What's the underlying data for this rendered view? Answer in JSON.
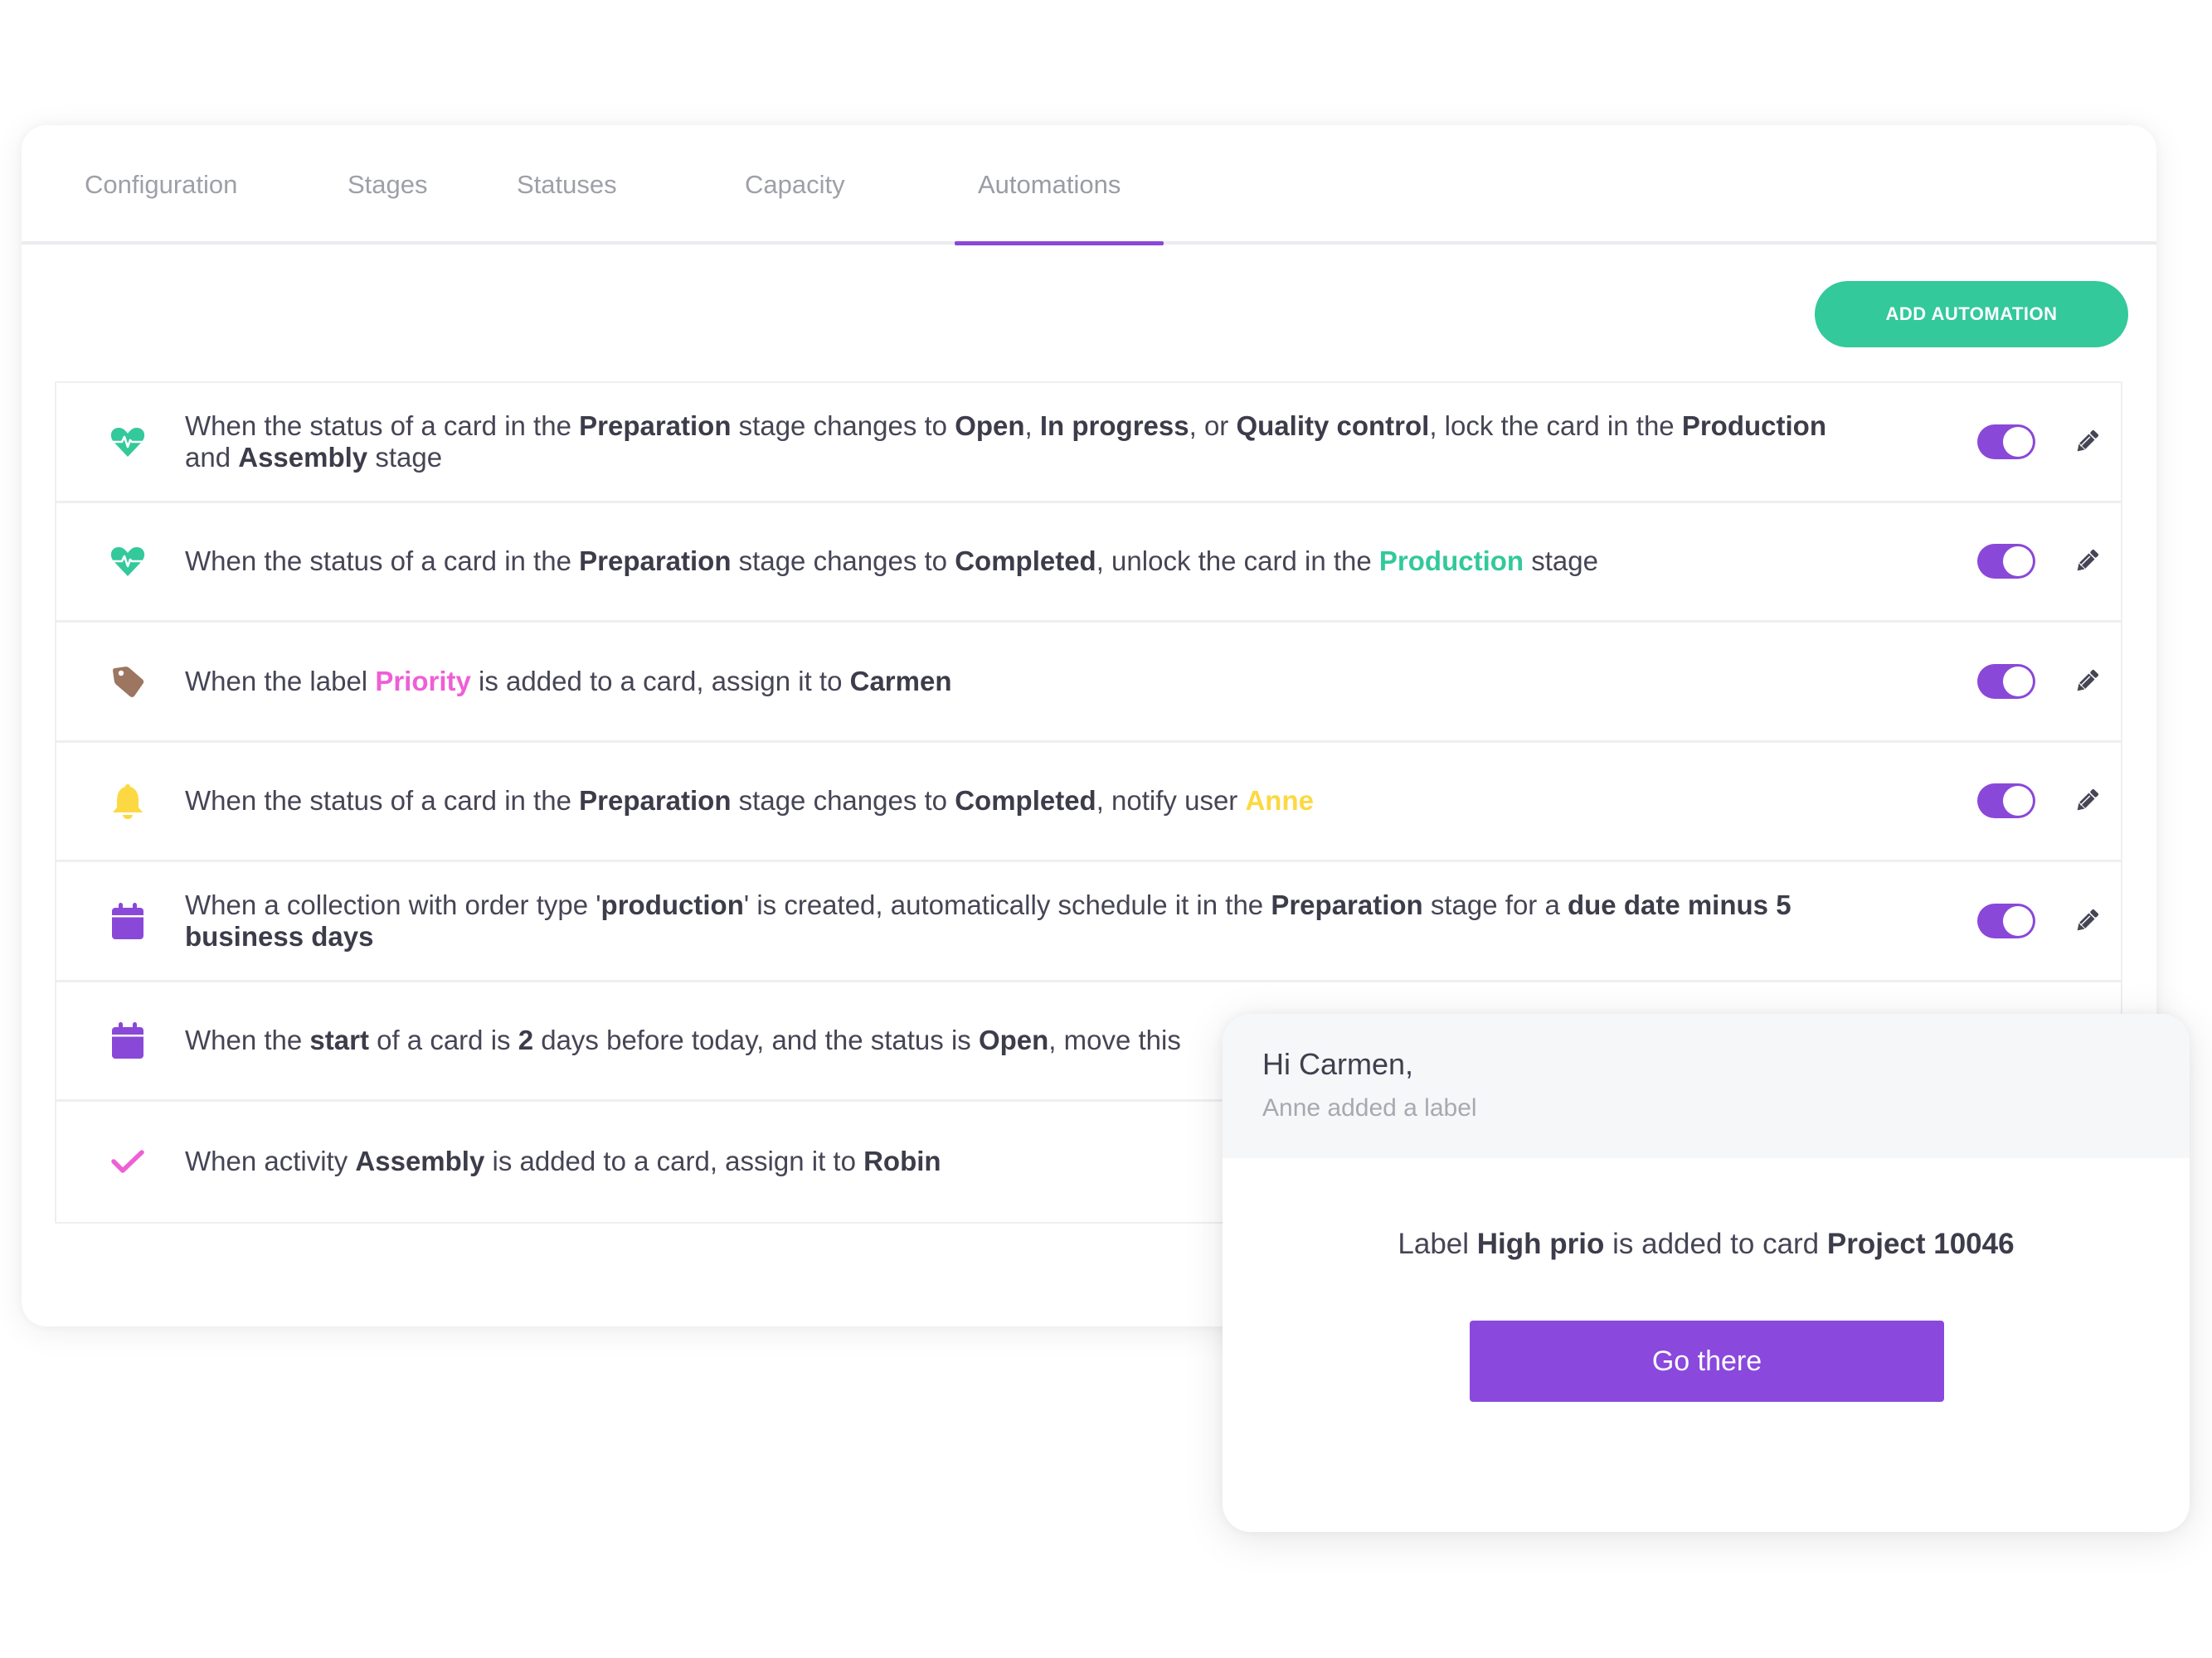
{
  "tabs": [
    {
      "label": "Configuration",
      "active": false
    },
    {
      "label": "Stages",
      "active": false
    },
    {
      "label": "Statuses",
      "active": false
    },
    {
      "label": "Capacity",
      "active": false
    },
    {
      "label": "Automations",
      "active": true
    }
  ],
  "toolbar": {
    "add_automation_label": "ADD AUTOMATION"
  },
  "colors": {
    "accent_purple": "#8a48d8",
    "accent_green": "#33c99a",
    "pink": "#ee5fd6",
    "yellow": "#fcd942",
    "tag_brown": "#9c7661"
  },
  "automations": [
    {
      "icon": "heartbeat-icon",
      "enabled": true,
      "parts": [
        {
          "t": "When the status of a card in the "
        },
        {
          "t": "Preparation",
          "s": "b"
        },
        {
          "t": " stage changes to "
        },
        {
          "t": "Open",
          "s": "b"
        },
        {
          "t": ", "
        },
        {
          "t": "In progress",
          "s": "b"
        },
        {
          "t": ", or "
        },
        {
          "t": "Quality control",
          "s": "b"
        },
        {
          "t": ", lock the card in the "
        },
        {
          "t": "Production",
          "s": "b"
        },
        {
          "t": " and "
        },
        {
          "t": "Assembly",
          "s": "b"
        },
        {
          "t": " stage"
        }
      ]
    },
    {
      "icon": "heartbeat-icon",
      "enabled": true,
      "parts": [
        {
          "t": "When the status of a card in the "
        },
        {
          "t": "Preparation",
          "s": "b"
        },
        {
          "t": " stage changes to "
        },
        {
          "t": "Completed",
          "s": "b"
        },
        {
          "t": ", unlock the card in the "
        },
        {
          "t": "Production",
          "s": "green"
        },
        {
          "t": " stage"
        }
      ]
    },
    {
      "icon": "tag-icon",
      "enabled": true,
      "parts": [
        {
          "t": "When the label "
        },
        {
          "t": "Priority",
          "s": "pink"
        },
        {
          "t": " is added to a card, assign it to "
        },
        {
          "t": "Carmen",
          "s": "b"
        }
      ]
    },
    {
      "icon": "bell-icon",
      "enabled": true,
      "parts": [
        {
          "t": "When the status of a card in the "
        },
        {
          "t": "Preparation",
          "s": "b"
        },
        {
          "t": " stage changes to "
        },
        {
          "t": "Completed",
          "s": "b"
        },
        {
          "t": ", notify user "
        },
        {
          "t": "Anne",
          "s": "yellow"
        }
      ]
    },
    {
      "icon": "calendar-icon",
      "enabled": true,
      "parts": [
        {
          "t": "When a collection with order type '"
        },
        {
          "t": "production",
          "s": "b"
        },
        {
          "t": "' is created, automatically schedule it in the "
        },
        {
          "t": "Preparation",
          "s": "b"
        },
        {
          "t": " stage for a "
        },
        {
          "t": "due date minus 5 business days",
          "s": "b"
        }
      ]
    },
    {
      "icon": "calendar-icon",
      "enabled": true,
      "parts": [
        {
          "t": "When the "
        },
        {
          "t": "start",
          "s": "b"
        },
        {
          "t": " of a card is "
        },
        {
          "t": "2",
          "s": "b"
        },
        {
          "t": " days before today, and the status is "
        },
        {
          "t": "Open",
          "s": "b"
        },
        {
          "t": ", move this"
        }
      ]
    },
    {
      "icon": "check-icon",
      "enabled": true,
      "parts": [
        {
          "t": "When activity "
        },
        {
          "t": "Assembly",
          "s": "b"
        },
        {
          "t": " is added to a card, assign it to "
        },
        {
          "t": "Robin",
          "s": "b"
        }
      ]
    }
  ],
  "notification": {
    "greeting": "Hi Carmen,",
    "subtitle": "Anne added a label",
    "message_parts": [
      {
        "t": "Label "
      },
      {
        "t": "High prio",
        "s": "b"
      },
      {
        "t": " is added to card "
      },
      {
        "t": "Project 10046",
        "s": "b"
      }
    ],
    "button_label": "Go there"
  }
}
